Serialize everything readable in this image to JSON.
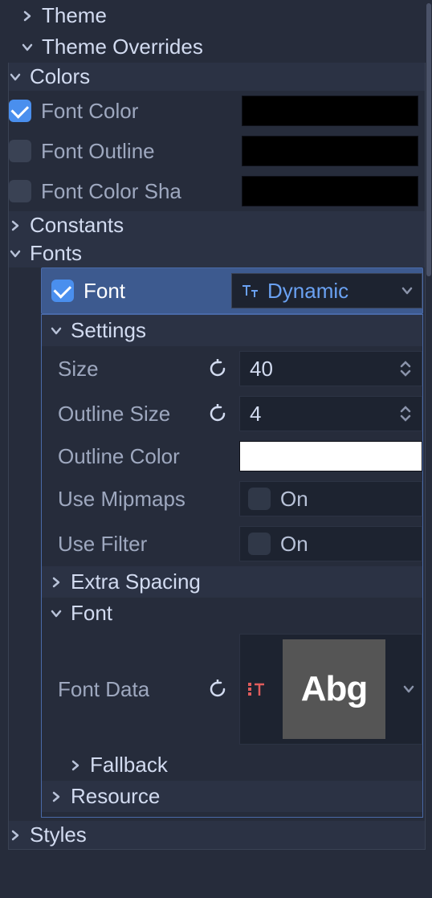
{
  "sections": {
    "theme": "Theme",
    "overrides": "Theme Overrides",
    "colors": "Colors",
    "constants": "Constants",
    "fonts": "Fonts",
    "settings": "Settings",
    "extra_spacing": "Extra Spacing",
    "font_sub": "Font",
    "fallback": "Fallback",
    "resource": "Resource",
    "styles": "Styles"
  },
  "colors": {
    "font_color": {
      "label": "Font Color",
      "value": "#000000",
      "enabled": true
    },
    "font_outline": {
      "label": "Font Outline",
      "value": "#000000",
      "enabled": false
    },
    "font_color_shadow": {
      "label": "Font Color Sha",
      "value": "#000000",
      "enabled": false
    }
  },
  "font": {
    "label": "Font",
    "type": "Dynamic",
    "enabled": true
  },
  "settings": {
    "size": {
      "label": "Size",
      "value": "40"
    },
    "outline_size": {
      "label": "Outline Size",
      "value": "4"
    },
    "outline_color": {
      "label": "Outline Color",
      "value": "#ffffff"
    },
    "use_mipmaps": {
      "label": "Use Mipmaps",
      "text": "On",
      "value": false
    },
    "use_filter": {
      "label": "Use Filter",
      "text": "On",
      "value": false
    }
  },
  "font_data": {
    "label": "Font Data",
    "preview": "Abg"
  }
}
